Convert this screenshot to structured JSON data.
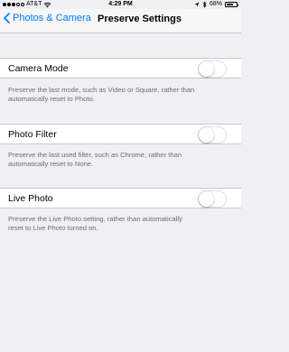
{
  "status_bar": {
    "carrier": "AT&T",
    "time": "4:29 PM",
    "battery_percent": "68%",
    "battery_level": 0.68
  },
  "nav": {
    "back_label": "Photos & Camera",
    "title": "Preserve Settings"
  },
  "settings": [
    {
      "label": "Camera Mode",
      "enabled": false,
      "footer": [
        "Preserve the last mode, such as Video or Square, rather than",
        "automatically reset to Photo."
      ]
    },
    {
      "label": "Photo Filter",
      "enabled": false,
      "footer": [
        "Preserve the last used filter, such as Chrome, rather than",
        "automatically reset to None."
      ]
    },
    {
      "label": "Live Photo",
      "enabled": false,
      "footer": [
        "Preserve the Live Photo setting, rather than automatically",
        "reset to Live Photo turned on."
      ]
    }
  ],
  "colors": {
    "accent": "#007aff",
    "background": "#efeff4",
    "footer_text": "#6d6d72",
    "separator": "#c8c7cc"
  }
}
